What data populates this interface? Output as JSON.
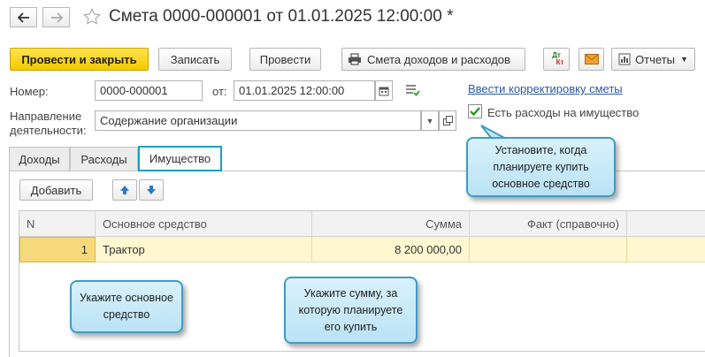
{
  "window": {
    "title": "Смета 0000-000001 от 01.01.2025 12:00:00 *"
  },
  "toolbar": {
    "post_and_close": "Провести и закрыть",
    "save": "Записать",
    "post": "Провести",
    "budget_report": "Смета доходов и расходов",
    "dt_kt_top": "Дт",
    "dt_kt_bottom": "Кт",
    "reports": "Отчеты"
  },
  "form": {
    "number_label": "Номер:",
    "number_value": "0000-000001",
    "from_label": "от:",
    "date_value": "01.01.2025 12:00:00",
    "direction_label_line1": "Направление",
    "direction_label_line2": "деятельности:",
    "direction_value": "Содержание организации",
    "adjust_link": "Ввести корректировку сметы",
    "property_expenses_label": "Есть расходы на имущество",
    "property_expenses_checked": true
  },
  "tabs": [
    {
      "label": "Доходы"
    },
    {
      "label": "Расходы"
    },
    {
      "label": "Имущество",
      "active": true
    }
  ],
  "table_toolbar": {
    "add": "Добавить"
  },
  "table": {
    "columns": [
      "N",
      "Основное средство",
      "Сумма",
      "Факт (справочно)"
    ],
    "rows": [
      {
        "n": "1",
        "asset": "Трактор",
        "sum": "8 200 000,00",
        "fact": ""
      }
    ]
  },
  "callouts": {
    "top_right": [
      "Установите, когда",
      "планируете купить",
      "основное средство"
    ],
    "bottom_left": [
      "Укажите основное",
      "средство"
    ],
    "bottom_middle": [
      "Укажите сумму, за",
      "которую планируете",
      "его купить"
    ]
  },
  "colors": {
    "primary_button": "#f4c900",
    "selected_row": "#fff7cf",
    "callout_border": "#3f9bc8",
    "active_tab_border": "#1aa0c4",
    "link": "#2a5aa8"
  }
}
